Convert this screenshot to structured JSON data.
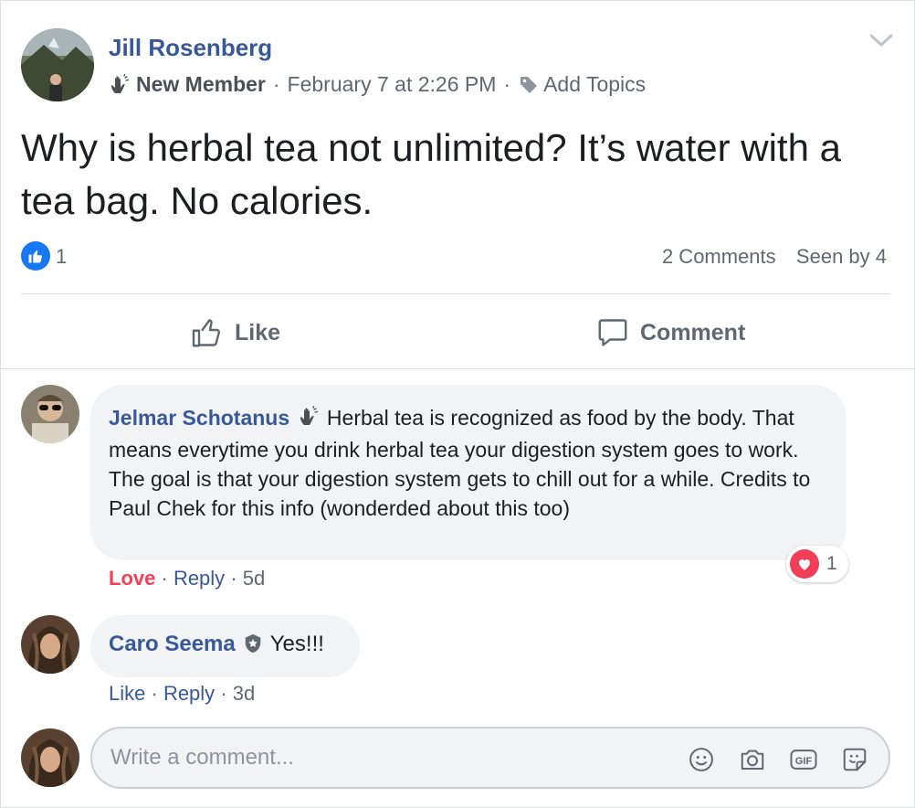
{
  "post": {
    "author": "Jill Rosenberg",
    "badge": "New Member",
    "timestamp": "February 7 at 2:26 PM",
    "topics_label": "Add Topics",
    "text": "Why is herbal tea not unlimited? It’s water with a tea bag. No calories.",
    "like_count": "1",
    "comments_count": "2 Comments",
    "seen_by": "Seen by 4",
    "like_label": "Like",
    "comment_label": "Comment"
  },
  "comments": [
    {
      "author": "Jelmar Schotanus",
      "text": "Herbal tea is recognized as food by the body. That means everytime you drink herbal tea your digestion system goes to work. The goal is that your digestion system gets to chill out for a while. Credits to Paul Chek for this info (wonderded about this too)",
      "reaction_label": "Love",
      "reply_label": "Reply",
      "age": "5d",
      "reaction_count": "1"
    },
    {
      "author": "Caro Seema",
      "text": "Yes!!!",
      "like_label": "Like",
      "reply_label": "Reply",
      "age": "3d"
    }
  ],
  "composer": {
    "placeholder": "Write a comment..."
  },
  "colors": {
    "link": "#385898",
    "like_blue": "#1877f2",
    "love_red": "#f33e58",
    "muted": "#616770"
  }
}
